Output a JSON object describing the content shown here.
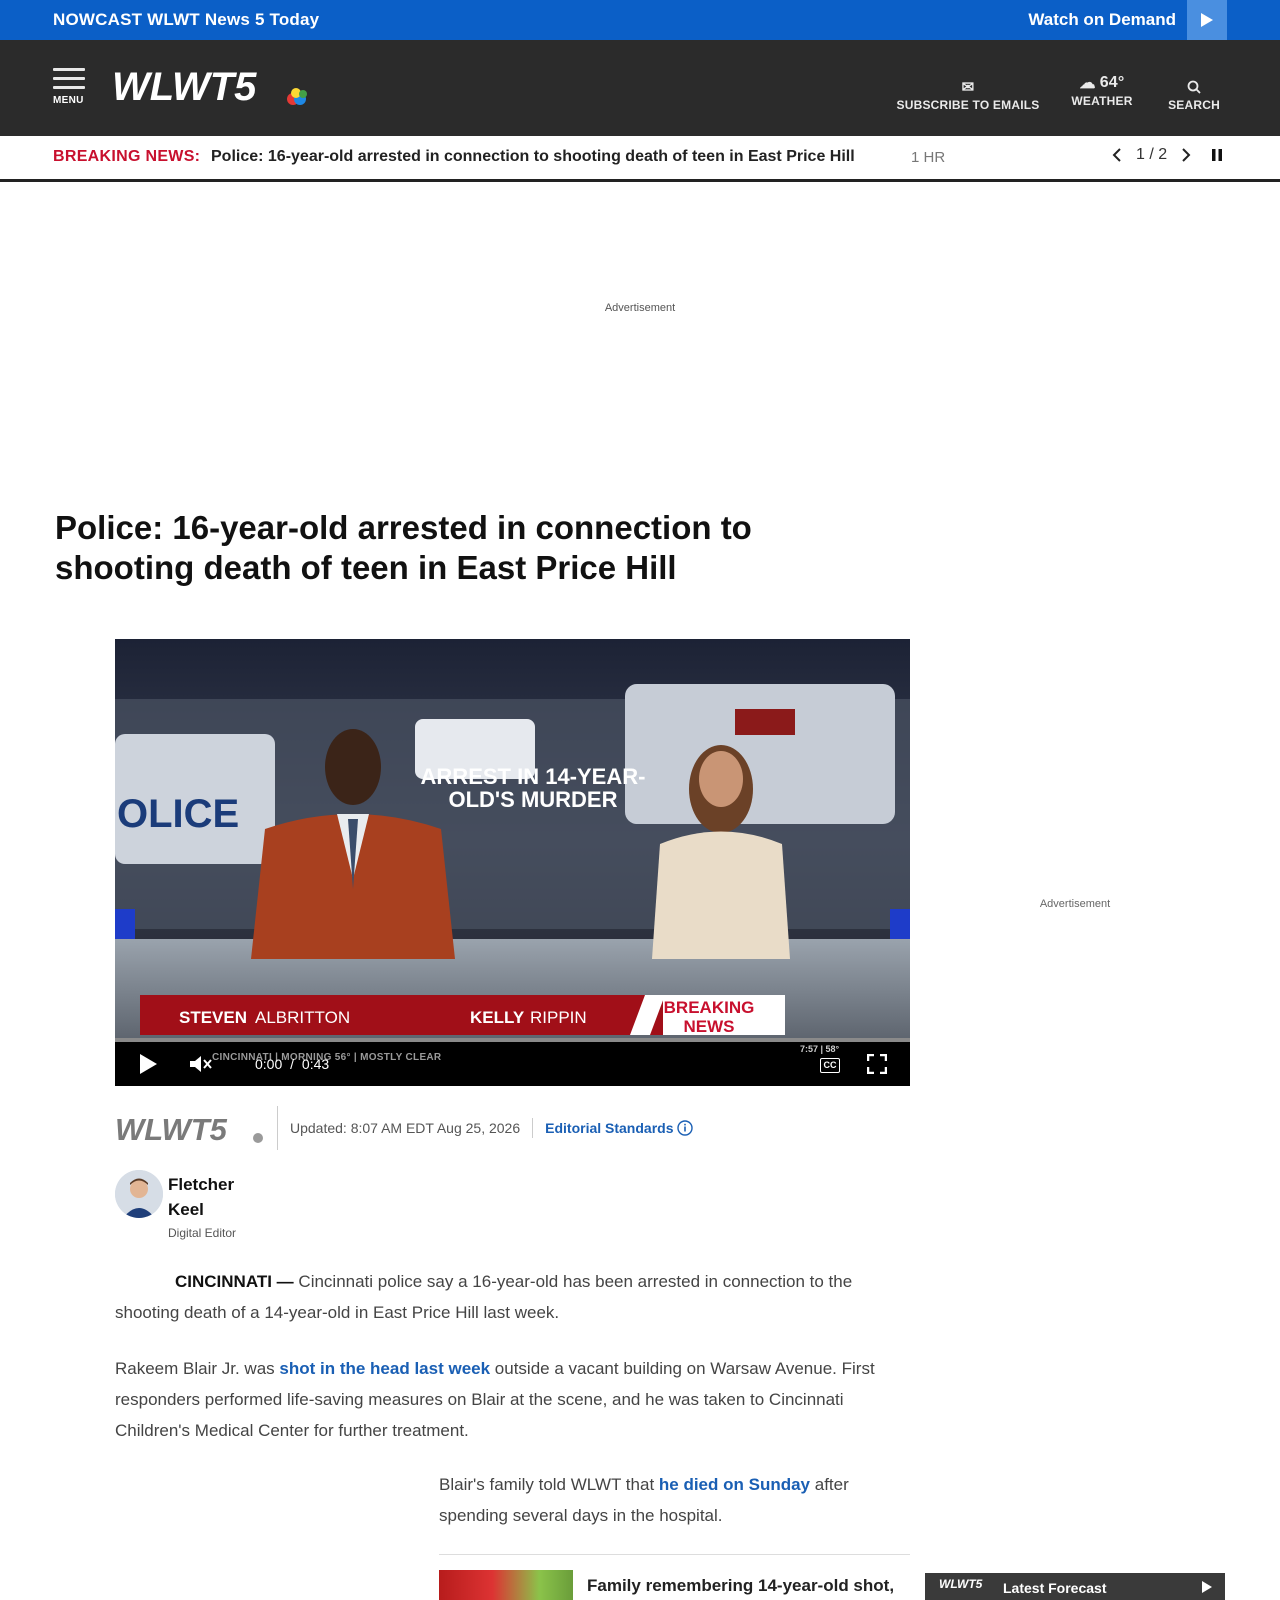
{
  "topbar": {
    "nowcast_prefix": "NOWCAST",
    "nowcast_title": "WLWT News 5 Today",
    "watch_label": "Watch on Demand"
  },
  "header": {
    "menu_label": "MENU",
    "logo_text": "WLWT5",
    "subscribe_label": "SUBSCRIBE TO EMAILS",
    "weather_temp": "64°",
    "weather_label": "WEATHER",
    "search_label": "SEARCH"
  },
  "breaking": {
    "label": "BREAKING NEWS:",
    "headline": "Police: 16-year-old arrested in connection to shooting death of teen in East Price Hill",
    "ago": "1 HR",
    "pager": "1 / 2"
  },
  "ads": {
    "top_label": "Advertisement",
    "side_label": "Advertisement"
  },
  "article": {
    "title": "Police: 16-year-old arrested in connection to shooting death of teen in East Price Hill",
    "updated": "Updated: 8:07 AM EDT Aug 25, 2026",
    "editorial": "Editorial Standards",
    "author_first": "Fletcher",
    "author_last": "Keel",
    "author_role": "Digital Editor",
    "p1_dateline": "CINCINNATI —",
    "p1_text": " Cincinnati police say a 16-year-old has been arrested in connection to the shooting death of a 14-year-old in East Price Hill last week.",
    "p2_a": "Rakeem Blair Jr. was ",
    "p2_link": "shot in the head last week",
    "p2_b": " outside a vacant building on Warsaw Avenue. First responders performed life-saving measures on Blair at the scene, and he was taken to Cincinnati Children's Medical Center for further treatment.",
    "p3_a": "Blair's family told WLWT that ",
    "p3_link": "he died on Sunday",
    "p3_b": " after spending several days in the hospital.",
    "related_title": "Family remembering 14-year-old shot,"
  },
  "video": {
    "headline_line1": "ARREST IN 14-YEAR-",
    "headline_line2": "OLD'S MURDER",
    "anchor1_first": "STEVEN",
    "anchor1_last": "ALBRITTON",
    "anchor2_first": "KELLY",
    "anchor2_last": "RIPPIN",
    "breaking_line1": "BREAKING",
    "breaking_line2": "NEWS",
    "ticker": "CINCINNATI | MORNING 56° | MOSTLY CLEAR",
    "time_current": "0:00",
    "time_sep": "/",
    "time_total": "0:43",
    "clock": "7:57 | 58°",
    "cc_label": "CC",
    "progress": 0.0
  },
  "forecast": {
    "logo": "WLWT5",
    "label": "Latest Forecast"
  },
  "colors": {
    "brand_blue": "#0b5fc7",
    "header_dark": "#2b2b2b",
    "breaking_red": "#c8102e",
    "link_blue": "#1a5fb4"
  }
}
